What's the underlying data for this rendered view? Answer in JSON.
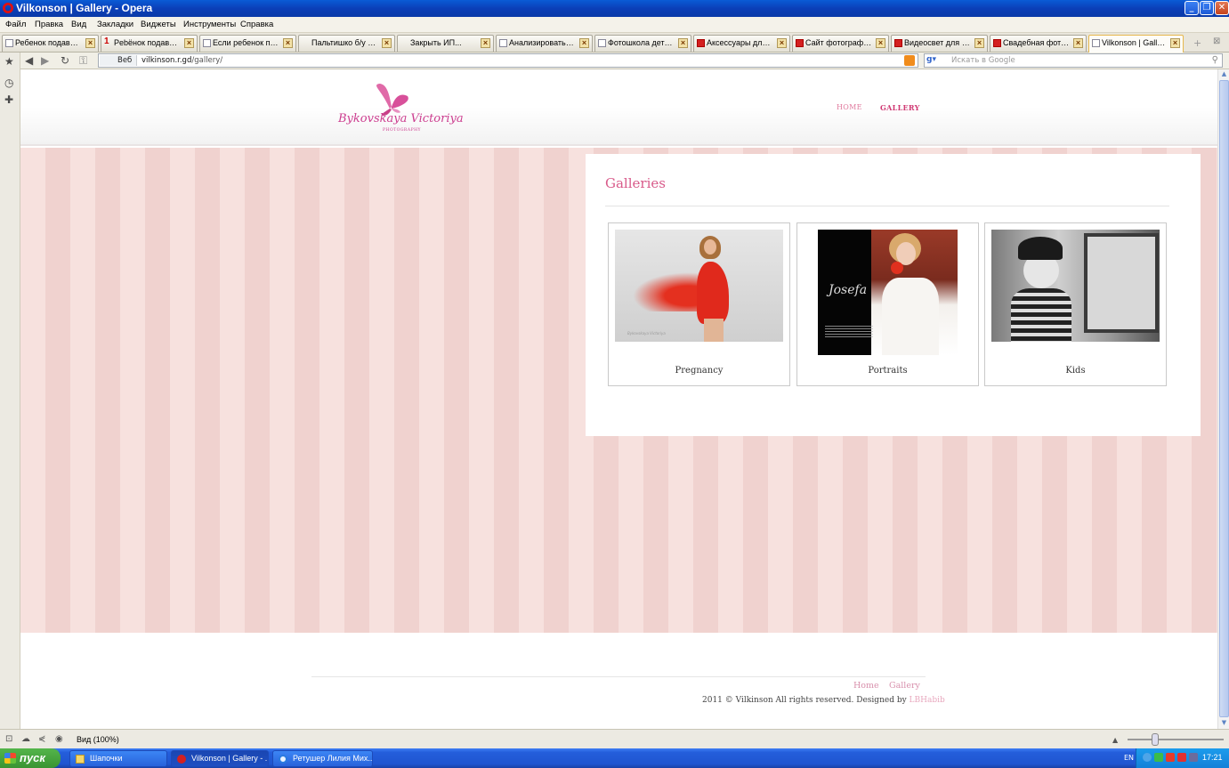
{
  "window": {
    "title": "Vilkonson | Gallery - Opera"
  },
  "menu": [
    "Файл",
    "Правка",
    "Вид",
    "Закладки",
    "Виджеты",
    "Инструменты",
    "Справка"
  ],
  "tabs": [
    {
      "label": "Ребенок подавилс..."
    },
    {
      "label": "Рebёнок подавилс...",
      "badge": "1"
    },
    {
      "label": "Если ребенок пода..."
    },
    {
      "label": "Пальтишко б/у в о..."
    },
    {
      "label": "Закрыть ИП..."
    },
    {
      "label": "Анализировать те..."
    },
    {
      "label": "Фотошкола детск..."
    },
    {
      "label": "Аксессуары для св..."
    },
    {
      "label": "Сайт фотографа. ..."
    },
    {
      "label": "Видеосвет для фо..."
    },
    {
      "label": "Свадебная фотосе..."
    },
    {
      "label": "Vilkonson | Gallery",
      "active": true
    }
  ],
  "address": {
    "prefix": "Веб",
    "url_host": "vilkinson.r.gd",
    "url_path": "/gallery/",
    "search_placeholder": "Искать в Google"
  },
  "site": {
    "logo": {
      "script": "Bykovskaya Victoriya",
      "sub": "PHOTOGRAPHY"
    },
    "nav": {
      "home": "HOME",
      "gallery": "GALLERY"
    },
    "galleries_title": "Galleries",
    "cards": [
      {
        "caption": "Pregnancy",
        "photo_sig": "Bykovskaya Victoriya"
      },
      {
        "caption": "Portraits",
        "photo_script": "Josefa"
      },
      {
        "caption": "Kids"
      }
    ],
    "footer": {
      "links": {
        "home": "Home",
        "gallery": "Gallery"
      },
      "copyright": "2011 © Vilkinson All rights reserved. Designed by ",
      "designer": "LBHabib"
    }
  },
  "statusbar": {
    "zoom": "Вид (100%)"
  },
  "taskbar": {
    "start": "пуск",
    "items": [
      {
        "label": "Шапочки"
      },
      {
        "label": "Vilkonson | Gallery - ...",
        "active": true
      },
      {
        "label": "Ретушер Лилия Мих..."
      }
    ],
    "lang": "EN",
    "clock": "17:21"
  },
  "colors": {
    "accent_pink": "#d85a8a",
    "band_pink": "#f4dcd9",
    "titlebar_blue": "#0b3fb8"
  }
}
